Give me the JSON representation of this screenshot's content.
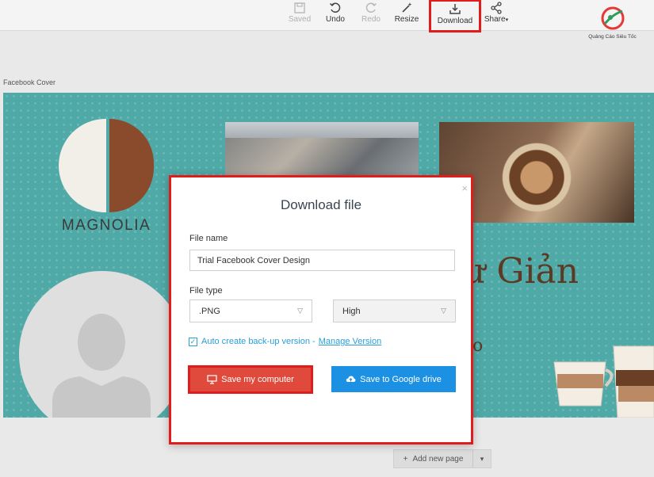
{
  "toolbar": {
    "saved_label": "Saved",
    "undo_label": "Undo",
    "redo_label": "Redo",
    "resize_label": "Resize",
    "download_label": "Download",
    "share_label": "Share"
  },
  "logo": {
    "text": "Quảng Cáo Siêu Tốc"
  },
  "canvas": {
    "label": "Facebook Cover",
    "brand_text": "MAGNOLIA",
    "serif_text": "ư Giản",
    "serif_small": "o"
  },
  "add_page": {
    "label": "Add new page"
  },
  "modal": {
    "title": "Download file",
    "close_icon": "×",
    "file_name_label": "File name",
    "file_name_value": "Trial Facebook Cover Design",
    "file_type_label": "File type",
    "file_type_value": ".PNG",
    "quality_value": "High",
    "backup_checked": true,
    "backup_text": "Auto create back-up version -",
    "manage_version_link": "Manage Version",
    "save_computer_label": "Save my computer",
    "save_drive_label": "Save to Google drive"
  },
  "colors": {
    "accent_red": "#e21b1b",
    "save_button": "#e04a3d",
    "drive_button": "#1c90e2",
    "canvas_bg": "#4fa9a7",
    "link": "#2a9fd6"
  }
}
